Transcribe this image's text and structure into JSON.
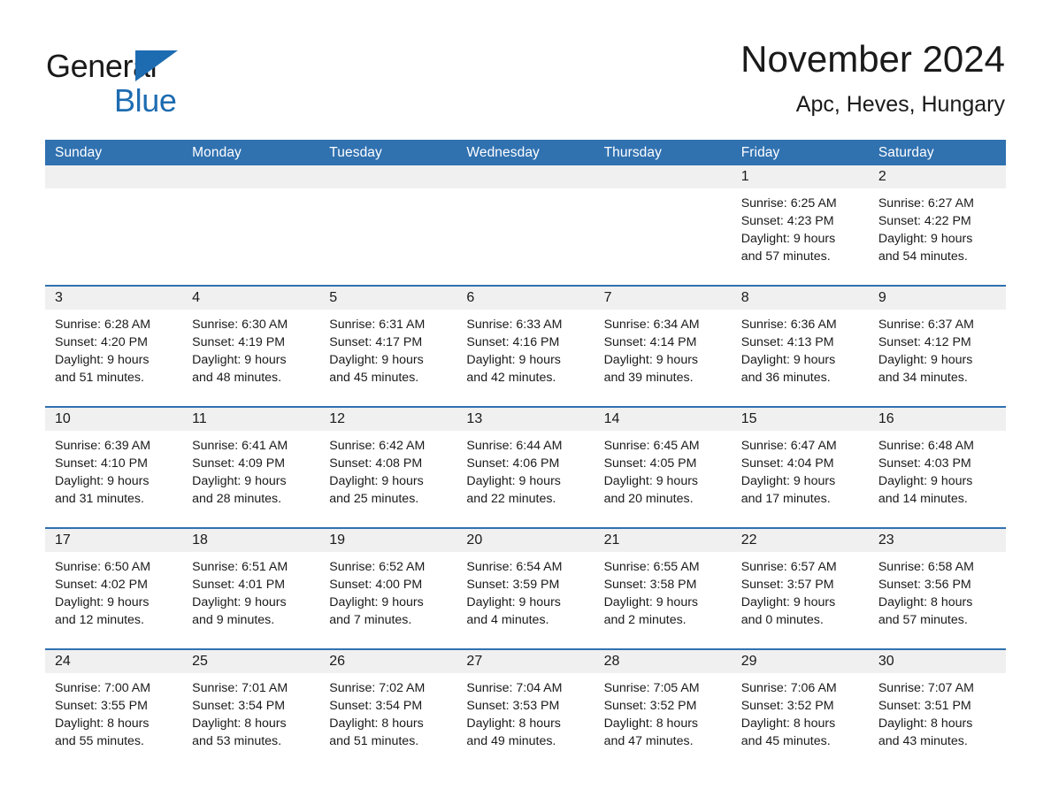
{
  "brand": {
    "name_top": "General",
    "name_bottom": "Blue",
    "accent_color": "#1D6CB1"
  },
  "header": {
    "title": "November 2024",
    "subtitle": "Apc, Heves, Hungary"
  },
  "calendar": {
    "header_bg": "#3071B0",
    "daynum_bg": "#F0F0F0",
    "weekdays": [
      "Sunday",
      "Monday",
      "Tuesday",
      "Wednesday",
      "Thursday",
      "Friday",
      "Saturday"
    ],
    "weeks": [
      [
        {
          "day": "",
          "empty": true
        },
        {
          "day": "",
          "empty": true
        },
        {
          "day": "",
          "empty": true
        },
        {
          "day": "",
          "empty": true
        },
        {
          "day": "",
          "empty": true
        },
        {
          "day": "1",
          "sunrise": "Sunrise: 6:25 AM",
          "sunset": "Sunset: 4:23 PM",
          "daylight": "Daylight: 9 hours and 57 minutes."
        },
        {
          "day": "2",
          "sunrise": "Sunrise: 6:27 AM",
          "sunset": "Sunset: 4:22 PM",
          "daylight": "Daylight: 9 hours and 54 minutes."
        }
      ],
      [
        {
          "day": "3",
          "sunrise": "Sunrise: 6:28 AM",
          "sunset": "Sunset: 4:20 PM",
          "daylight": "Daylight: 9 hours and 51 minutes."
        },
        {
          "day": "4",
          "sunrise": "Sunrise: 6:30 AM",
          "sunset": "Sunset: 4:19 PM",
          "daylight": "Daylight: 9 hours and 48 minutes."
        },
        {
          "day": "5",
          "sunrise": "Sunrise: 6:31 AM",
          "sunset": "Sunset: 4:17 PM",
          "daylight": "Daylight: 9 hours and 45 minutes."
        },
        {
          "day": "6",
          "sunrise": "Sunrise: 6:33 AM",
          "sunset": "Sunset: 4:16 PM",
          "daylight": "Daylight: 9 hours and 42 minutes."
        },
        {
          "day": "7",
          "sunrise": "Sunrise: 6:34 AM",
          "sunset": "Sunset: 4:14 PM",
          "daylight": "Daylight: 9 hours and 39 minutes."
        },
        {
          "day": "8",
          "sunrise": "Sunrise: 6:36 AM",
          "sunset": "Sunset: 4:13 PM",
          "daylight": "Daylight: 9 hours and 36 minutes."
        },
        {
          "day": "9",
          "sunrise": "Sunrise: 6:37 AM",
          "sunset": "Sunset: 4:12 PM",
          "daylight": "Daylight: 9 hours and 34 minutes."
        }
      ],
      [
        {
          "day": "10",
          "sunrise": "Sunrise: 6:39 AM",
          "sunset": "Sunset: 4:10 PM",
          "daylight": "Daylight: 9 hours and 31 minutes."
        },
        {
          "day": "11",
          "sunrise": "Sunrise: 6:41 AM",
          "sunset": "Sunset: 4:09 PM",
          "daylight": "Daylight: 9 hours and 28 minutes."
        },
        {
          "day": "12",
          "sunrise": "Sunrise: 6:42 AM",
          "sunset": "Sunset: 4:08 PM",
          "daylight": "Daylight: 9 hours and 25 minutes."
        },
        {
          "day": "13",
          "sunrise": "Sunrise: 6:44 AM",
          "sunset": "Sunset: 4:06 PM",
          "daylight": "Daylight: 9 hours and 22 minutes."
        },
        {
          "day": "14",
          "sunrise": "Sunrise: 6:45 AM",
          "sunset": "Sunset: 4:05 PM",
          "daylight": "Daylight: 9 hours and 20 minutes."
        },
        {
          "day": "15",
          "sunrise": "Sunrise: 6:47 AM",
          "sunset": "Sunset: 4:04 PM",
          "daylight": "Daylight: 9 hours and 17 minutes."
        },
        {
          "day": "16",
          "sunrise": "Sunrise: 6:48 AM",
          "sunset": "Sunset: 4:03 PM",
          "daylight": "Daylight: 9 hours and 14 minutes."
        }
      ],
      [
        {
          "day": "17",
          "sunrise": "Sunrise: 6:50 AM",
          "sunset": "Sunset: 4:02 PM",
          "daylight": "Daylight: 9 hours and 12 minutes."
        },
        {
          "day": "18",
          "sunrise": "Sunrise: 6:51 AM",
          "sunset": "Sunset: 4:01 PM",
          "daylight": "Daylight: 9 hours and 9 minutes."
        },
        {
          "day": "19",
          "sunrise": "Sunrise: 6:52 AM",
          "sunset": "Sunset: 4:00 PM",
          "daylight": "Daylight: 9 hours and 7 minutes."
        },
        {
          "day": "20",
          "sunrise": "Sunrise: 6:54 AM",
          "sunset": "Sunset: 3:59 PM",
          "daylight": "Daylight: 9 hours and 4 minutes."
        },
        {
          "day": "21",
          "sunrise": "Sunrise: 6:55 AM",
          "sunset": "Sunset: 3:58 PM",
          "daylight": "Daylight: 9 hours and 2 minutes."
        },
        {
          "day": "22",
          "sunrise": "Sunrise: 6:57 AM",
          "sunset": "Sunset: 3:57 PM",
          "daylight": "Daylight: 9 hours and 0 minutes."
        },
        {
          "day": "23",
          "sunrise": "Sunrise: 6:58 AM",
          "sunset": "Sunset: 3:56 PM",
          "daylight": "Daylight: 8 hours and 57 minutes."
        }
      ],
      [
        {
          "day": "24",
          "sunrise": "Sunrise: 7:00 AM",
          "sunset": "Sunset: 3:55 PM",
          "daylight": "Daylight: 8 hours and 55 minutes."
        },
        {
          "day": "25",
          "sunrise": "Sunrise: 7:01 AM",
          "sunset": "Sunset: 3:54 PM",
          "daylight": "Daylight: 8 hours and 53 minutes."
        },
        {
          "day": "26",
          "sunrise": "Sunrise: 7:02 AM",
          "sunset": "Sunset: 3:54 PM",
          "daylight": "Daylight: 8 hours and 51 minutes."
        },
        {
          "day": "27",
          "sunrise": "Sunrise: 7:04 AM",
          "sunset": "Sunset: 3:53 PM",
          "daylight": "Daylight: 8 hours and 49 minutes."
        },
        {
          "day": "28",
          "sunrise": "Sunrise: 7:05 AM",
          "sunset": "Sunset: 3:52 PM",
          "daylight": "Daylight: 8 hours and 47 minutes."
        },
        {
          "day": "29",
          "sunrise": "Sunrise: 7:06 AM",
          "sunset": "Sunset: 3:52 PM",
          "daylight": "Daylight: 8 hours and 45 minutes."
        },
        {
          "day": "30",
          "sunrise": "Sunrise: 7:07 AM",
          "sunset": "Sunset: 3:51 PM",
          "daylight": "Daylight: 8 hours and 43 minutes."
        }
      ]
    ]
  }
}
